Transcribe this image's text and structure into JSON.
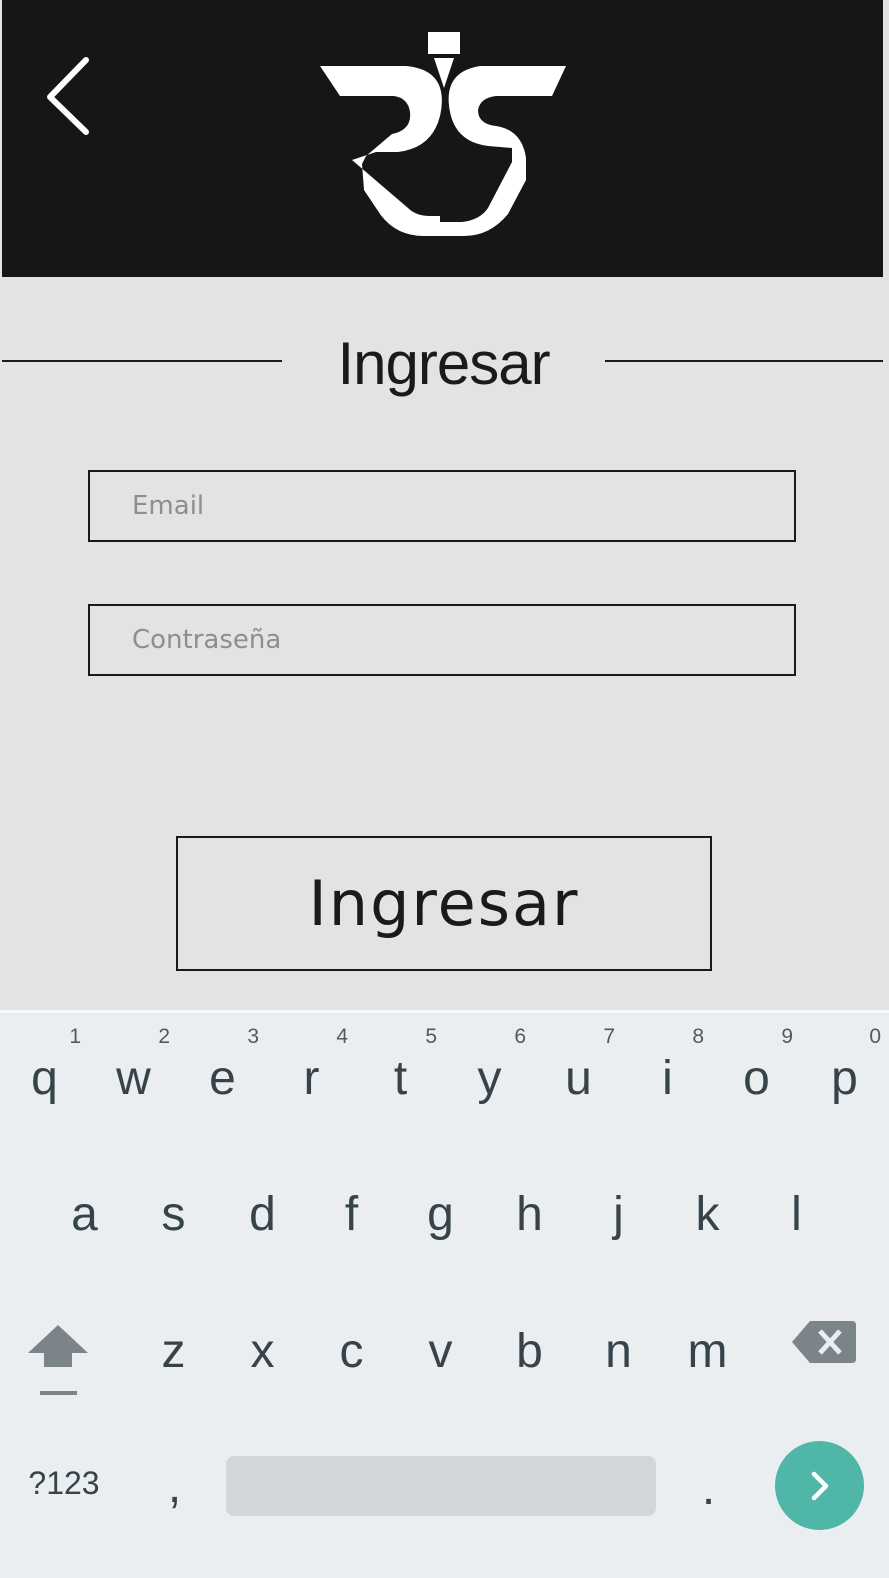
{
  "header": {
    "back_icon": "chevron-left-icon",
    "logo_icon": "brand-logo-icon"
  },
  "login": {
    "title": "Ingresar",
    "email_placeholder": "Email",
    "password_placeholder": "Contraseña",
    "submit_label": "Ingresar"
  },
  "keyboard": {
    "row1": [
      {
        "key": "q",
        "hint": "1"
      },
      {
        "key": "w",
        "hint": "2"
      },
      {
        "key": "e",
        "hint": "3"
      },
      {
        "key": "r",
        "hint": "4"
      },
      {
        "key": "t",
        "hint": "5"
      },
      {
        "key": "y",
        "hint": "6"
      },
      {
        "key": "u",
        "hint": "7"
      },
      {
        "key": "i",
        "hint": "8"
      },
      {
        "key": "o",
        "hint": "9"
      },
      {
        "key": "p",
        "hint": "0"
      }
    ],
    "row2": [
      "a",
      "s",
      "d",
      "f",
      "g",
      "h",
      "j",
      "k",
      "l"
    ],
    "row3": [
      "z",
      "x",
      "c",
      "v",
      "b",
      "n",
      "m"
    ],
    "symbols_label": "?123",
    "comma": ",",
    "period": ".",
    "shift_icon": "shift-arrow-icon",
    "backspace_icon": "backspace-icon",
    "enter_icon": "chevron-right-icon",
    "enter_color": "#4fb6a8"
  },
  "colors": {
    "header_bg": "#161616",
    "page_bg": "#e3e3e3",
    "keyboard_bg": "#eaeef1"
  }
}
